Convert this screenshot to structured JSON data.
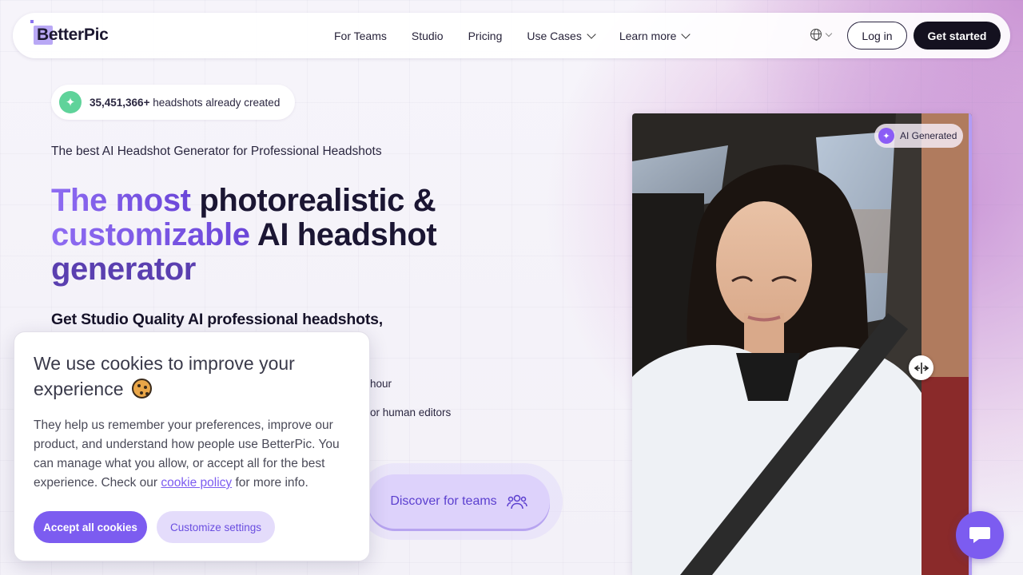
{
  "nav": {
    "logo": "BetterPic",
    "links": [
      {
        "label": "For Teams",
        "dropdown": false
      },
      {
        "label": "Studio",
        "dropdown": false
      },
      {
        "label": "Pricing",
        "dropdown": false
      },
      {
        "label": "Use Cases",
        "dropdown": true
      },
      {
        "label": "Learn more",
        "dropdown": true
      }
    ],
    "login_label": "Log in",
    "get_started_label": "Get started"
  },
  "hero": {
    "counter_value": "35,451,366+",
    "counter_text": "headshots already created",
    "tagline": "The best AI Headshot Generator for Professional Headshots",
    "headline_grad1": "The most",
    "headline_dark1": "photorealistic &",
    "headline_grad2": "customizable",
    "headline_dark2": "AI headshot",
    "headline_grad3": "generator",
    "subheadline": "Get Studio Quality AI professional headshots,",
    "feature_1_partial": "hour",
    "feature_2_partial": "or human editors",
    "teams_button_label": "Discover for teams"
  },
  "photo": {
    "badge_label": "AI Generated"
  },
  "cookie": {
    "title": "We use cookies to improve your experience",
    "body_before_link": "They help us remember your preferences, improve our product, and understand how people use BetterPic. You can manage what you allow, or accept all for the best experience. Check our",
    "link_text": "cookie policy",
    "body_after_link": "for more info.",
    "accept_label": "Accept all cookies",
    "customize_label": "Customize settings"
  },
  "colors": {
    "accent": "#7c5cf0",
    "dark": "#14111f",
    "counter_icon": "#5fd39a"
  },
  "icons": {
    "counter": "sparkle-icon",
    "language": "globe-icon",
    "teams": "users-icon",
    "badge": "sparkle-icon",
    "compare": "arrows-horizontal-icon",
    "chat": "chat-bubble-icon"
  }
}
